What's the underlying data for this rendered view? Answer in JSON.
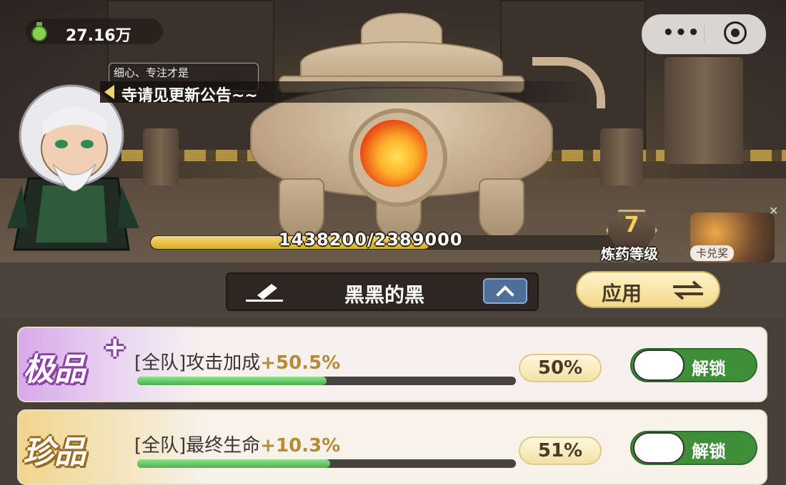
{
  "currency": {
    "value": "27.16万",
    "icon": "potion-icon"
  },
  "tip": {
    "text": "细心、专注才是"
  },
  "announcement": {
    "text": "寺请见更新公告~~"
  },
  "progress": {
    "current": 1438200,
    "max": 2389000,
    "text": "1438200/2389000"
  },
  "alchemy_level": {
    "value": "7",
    "label": "炼药等级"
  },
  "ad": {
    "label": "卡兑奖"
  },
  "preset": {
    "name": "黑黑的黑",
    "apply_label": "应用"
  },
  "cards": [
    {
      "grade": "极品",
      "plus": "+",
      "attr_prefix": "[全队]攻击加成",
      "attr_bonus": "+50.5%",
      "percent": "50%",
      "fill": 0.5,
      "toggle_label": "解锁"
    },
    {
      "grade": "珍品",
      "plus": "",
      "attr_prefix": "[全队]最终生命",
      "attr_bonus": "+10.3%",
      "percent": "51%",
      "fill": 0.51,
      "toggle_label": "解锁"
    }
  ],
  "colors": {
    "accent_gold": "#d6ac2c",
    "toggle_green": "#3e8e3a",
    "epic_purple": "#8e3fa8",
    "rare_gold": "#9b6b22"
  }
}
